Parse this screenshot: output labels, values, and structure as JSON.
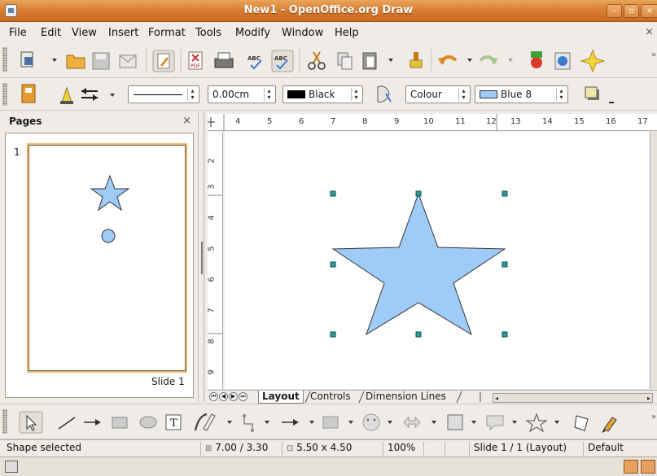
{
  "window": {
    "title": "New1 - OpenOffice.org Draw"
  },
  "menu": [
    "File",
    "Edit",
    "View",
    "Insert",
    "Format",
    "Tools",
    "Modify",
    "Window",
    "Help"
  ],
  "menu_close": "×",
  "standard_toolbar": {
    "icons": [
      "new-document-icon",
      "open-folder-icon",
      "save-icon",
      "email-icon",
      "edit-file-icon",
      "export-pdf-icon",
      "print-icon",
      "spellcheck-icon",
      "autospellcheck-icon",
      "cut-icon",
      "copy-icon",
      "paste-icon",
      "format-paintbrush-icon",
      "undo-icon",
      "redo-icon",
      "draw-functions-icon",
      "navigator-icon",
      "gluepoints-icon"
    ]
  },
  "line_fill_toolbar": {
    "line_width": "0.00cm",
    "line_color": "Black",
    "line_color_hex": "#000000",
    "area_style": "Colour",
    "area_color": "Blue 8",
    "area_color_hex": "#9ecbf7"
  },
  "pages_pane": {
    "title": "Pages",
    "close": "×",
    "page_number": "1",
    "slide_label": "Slide 1"
  },
  "rulers": {
    "horizontal_ticks": [
      "4",
      "5",
      "6",
      "7",
      "8",
      "9",
      "10",
      "11",
      "12",
      "13",
      "14",
      "15",
      "16",
      "17"
    ],
    "vertical_ticks": [
      "2",
      "3",
      "4",
      "5",
      "6",
      "7",
      "8",
      "9"
    ]
  },
  "shape": {
    "fill": "#9ecbf7",
    "stroke": "#333333",
    "handle_color": "#2a9b9b"
  },
  "tabs": {
    "items": [
      "Layout",
      "Controls",
      "Dimension Lines"
    ],
    "active": "Layout"
  },
  "drawing_toolbar": {
    "icons": [
      "select-arrow-icon",
      "line-icon",
      "line-arrow-icon",
      "rectangle-icon",
      "ellipse-icon",
      "text-icon",
      "curve-icon",
      "connector-icon",
      "lines-arrows-icon",
      "basic-shapes-icon",
      "symbol-shapes-icon",
      "block-arrows-icon",
      "flowchart-icon",
      "callouts-icon",
      "stars-icon",
      "points-icon",
      "gluepoints-tool-icon"
    ]
  },
  "statusbar": {
    "status": "Shape selected",
    "position": "7.00 / 3.30",
    "size": "5.50 x 4.50",
    "zoom": "100%",
    "slide": "Slide 1 / 1 (Layout)",
    "layout": "Default"
  }
}
